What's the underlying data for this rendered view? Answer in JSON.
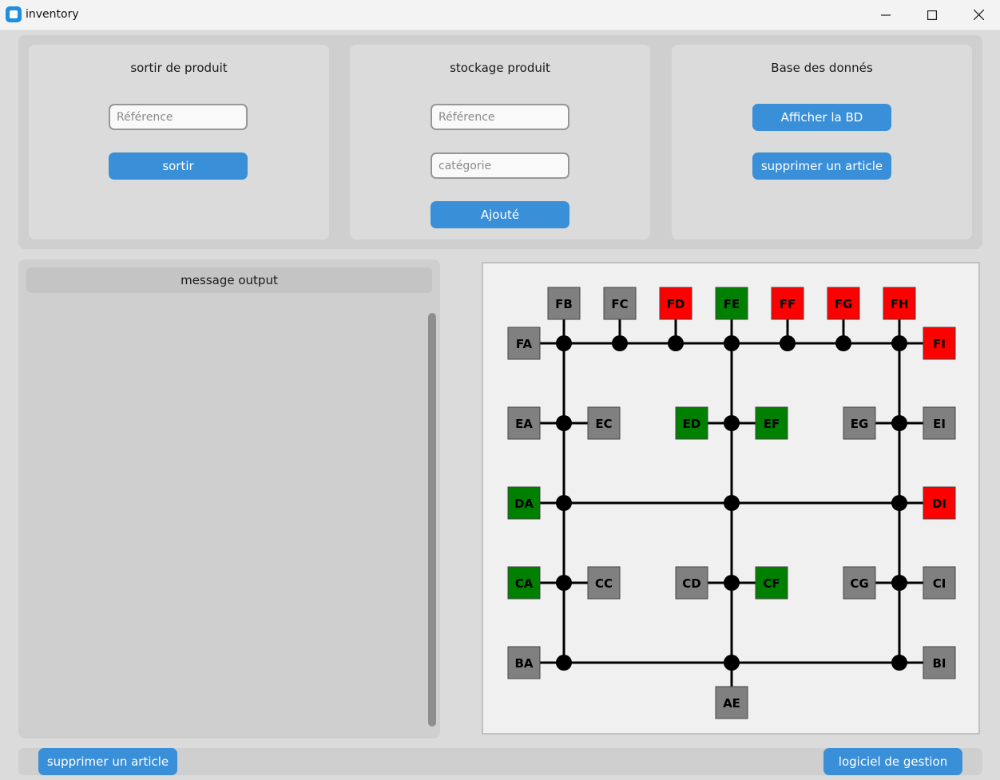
{
  "window": {
    "title": "inventory"
  },
  "sections": {
    "sortir": {
      "title": "sortir de produit",
      "reference_placeholder": "Référence",
      "button": "sortir"
    },
    "stockage": {
      "title": "stockage produit",
      "reference_placeholder": "Référence",
      "category_placeholder": "catégorie",
      "button": "Ajouté"
    },
    "base": {
      "title": "Base des donnés",
      "show_button": "Afficher la BD",
      "delete_button": "supprimer un article"
    }
  },
  "message_output": {
    "label": "message output"
  },
  "bottom": {
    "left_button": "supprimer un article",
    "right_button": "logiciel de gestion"
  },
  "colors": {
    "gray": "#808080",
    "green": "#008000",
    "red": "#ff0000",
    "accent": "#3a8fd9"
  },
  "diagram": {
    "nodes": [
      {
        "id": "FB",
        "status": "gray"
      },
      {
        "id": "FC",
        "status": "gray"
      },
      {
        "id": "FD",
        "status": "red"
      },
      {
        "id": "FE",
        "status": "green"
      },
      {
        "id": "FF",
        "status": "red"
      },
      {
        "id": "FG",
        "status": "red"
      },
      {
        "id": "FH",
        "status": "red"
      },
      {
        "id": "FA",
        "status": "gray"
      },
      {
        "id": "FI",
        "status": "red"
      },
      {
        "id": "EA",
        "status": "gray"
      },
      {
        "id": "EC",
        "status": "gray"
      },
      {
        "id": "ED",
        "status": "green"
      },
      {
        "id": "EF",
        "status": "green"
      },
      {
        "id": "EG",
        "status": "gray"
      },
      {
        "id": "EI",
        "status": "gray"
      },
      {
        "id": "DA",
        "status": "green"
      },
      {
        "id": "DI",
        "status": "red"
      },
      {
        "id": "CA",
        "status": "green"
      },
      {
        "id": "CC",
        "status": "gray"
      },
      {
        "id": "CD",
        "status": "gray"
      },
      {
        "id": "CF",
        "status": "green"
      },
      {
        "id": "CG",
        "status": "gray"
      },
      {
        "id": "CI",
        "status": "gray"
      },
      {
        "id": "BA",
        "status": "gray"
      },
      {
        "id": "BI",
        "status": "gray"
      },
      {
        "id": "AE",
        "status": "gray"
      }
    ]
  }
}
